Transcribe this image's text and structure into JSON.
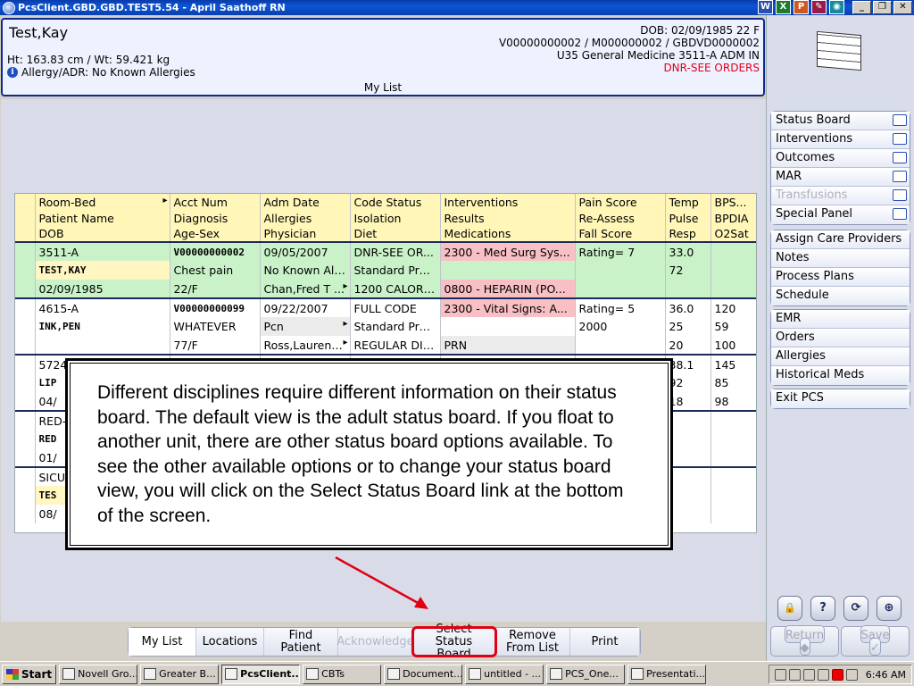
{
  "window": {
    "title": "PcsClient.GBD.GBD.TEST5.54 - April Saathoff RN",
    "tray_icons": [
      "W",
      "X",
      "P",
      "✎",
      "◉"
    ],
    "controls": [
      "_",
      "❐",
      "✕"
    ]
  },
  "patient": {
    "name": "Test,Kay",
    "ht_wt": "Ht: 163.83 cm / Wt: 59.421 kg",
    "allergy": "Allergy/ADR: No Known Allergies",
    "dob": "DOB: 02/09/1985 22 F",
    "ids": "V00000000002 / M000000002 / GBDVD0000002",
    "unit": "U35 General Medicine  3511-A  ADM IN",
    "code": "DNR-SEE ORDERS",
    "list_label": "My List"
  },
  "nav": {
    "group1": [
      {
        "label": "Status Board",
        "icon": "status-board-icon",
        "disabled": false
      },
      {
        "label": "Interventions",
        "icon": "interventions-icon",
        "disabled": false
      },
      {
        "label": "Outcomes",
        "icon": "outcomes-icon",
        "disabled": false
      },
      {
        "label": "MAR",
        "icon": "mar-icon",
        "disabled": false
      },
      {
        "label": "Transfusions",
        "icon": "transfusions-icon",
        "disabled": true
      },
      {
        "label": "Special Panel",
        "icon": "special-panel-icon",
        "disabled": false
      }
    ],
    "group2": [
      "Assign Care Providers",
      "Notes",
      "Process Plans",
      "Schedule"
    ],
    "group3": [
      "EMR",
      "Orders",
      "Allergies",
      "Historical Meds"
    ],
    "group4": [
      "Exit PCS"
    ],
    "tools": [
      "🔒",
      "?",
      "⟳",
      "⊕"
    ],
    "return_label": "Return",
    "save_label": "Save"
  },
  "table": {
    "headers": [
      [
        "Room-Bed",
        "Acct Num",
        "Adm Date",
        "Code Status",
        "Interventions",
        "Pain Score",
        "Temp",
        "BPS..."
      ],
      [
        "Patient Name",
        "Diagnosis",
        "Allergies",
        "Isolation",
        "Results",
        "Re-Assess",
        "Pulse",
        "BPDIA"
      ],
      [
        "DOB",
        "Age-Sex",
        "Physician",
        "Diet",
        "Medications",
        "Fall Score",
        "Resp",
        "O2Sat"
      ]
    ],
    "rows": [
      [
        "3511-A",
        "V00000000002",
        "09/05/2007",
        "DNR-SEE OR...",
        "2300 - Med Surg Sys...",
        "Rating= 7",
        "33.0",
        ""
      ],
      [
        "TEST,KAY",
        "Chest pain",
        "No Known All...",
        "Standard Pre...",
        "",
        "",
        "72",
        ""
      ],
      [
        "02/09/1985",
        "22/F",
        "Chan,Fred T ...",
        "1200 CALORI...",
        "0800 - HEPARIN (PO...",
        "",
        "",
        ""
      ],
      [
        "4615-A",
        "V00000000099",
        "09/22/2007",
        "FULL CODE",
        "2300 - Vital Signs: A...",
        "Rating= 5",
        "36.0",
        "120"
      ],
      [
        "INK,PEN",
        "WHATEVER",
        "Pcn",
        "Standard Pre...",
        "",
        "2000",
        "25",
        "59"
      ],
      [
        "",
        "77/F",
        "Ross,Laurenc...",
        "REGULAR DIET",
        "PRN",
        "",
        "20",
        "100"
      ],
      [
        "5724",
        "",
        "",
        "",
        "",
        "",
        "38.1",
        "145"
      ],
      [
        "LIP",
        "",
        "",
        "",
        "",
        "",
        "92",
        "85"
      ],
      [
        "04/",
        "",
        "",
        "",
        "",
        "",
        "18",
        "98"
      ],
      [
        "RED-",
        "",
        "",
        "",
        "",
        "",
        "",
        ""
      ],
      [
        "RED",
        "",
        "",
        "",
        "",
        "",
        "",
        ""
      ],
      [
        "01/",
        "",
        "",
        "",
        "",
        "",
        "",
        ""
      ],
      [
        "SICU",
        "",
        "",
        "",
        "",
        "",
        "",
        ""
      ],
      [
        "TES",
        "",
        "",
        "",
        "",
        "",
        "",
        ""
      ],
      [
        "08/",
        "",
        "",
        "",
        "",
        "",
        "",
        ""
      ]
    ]
  },
  "callout": {
    "text": "Different disciplines require different information on their status board. The default view is the adult status board. If you float to another unit, there are other status board options available. To see the other available options or to change your status board view, you will click on the Select Status Board link at the bottom of the screen."
  },
  "bottom_tabs": [
    {
      "label": "My List",
      "state": "active"
    },
    {
      "label": "Locations",
      "state": "normal"
    },
    {
      "label": "Find Patient",
      "state": "normal"
    },
    {
      "label": "Acknowledge",
      "state": "disabled"
    },
    {
      "label": "Select Status Board",
      "state": "highlight"
    },
    {
      "label": "Remove From List",
      "state": "normal"
    },
    {
      "label": "Print",
      "state": "normal"
    }
  ],
  "taskbar": {
    "start_label": "Start",
    "tasks": [
      {
        "label": "Novell Gro...",
        "active": false
      },
      {
        "label": "Greater B...",
        "active": false
      },
      {
        "label": "PcsClient...",
        "active": true
      },
      {
        "label": "CBTs",
        "active": false
      },
      {
        "label": "Document...",
        "active": false
      },
      {
        "label": "untitled - ...",
        "active": false
      },
      {
        "label": "PCS_One...",
        "active": false
      },
      {
        "label": "Presentati...",
        "active": false
      }
    ],
    "clock": "6:46 AM"
  },
  "colors": {
    "header_yellow": "#fff6b8",
    "row_green": "#c9f2c9",
    "row_pink": "#f8c0c4",
    "code_red": "#e0001a",
    "highlight_red": "#e00012"
  }
}
